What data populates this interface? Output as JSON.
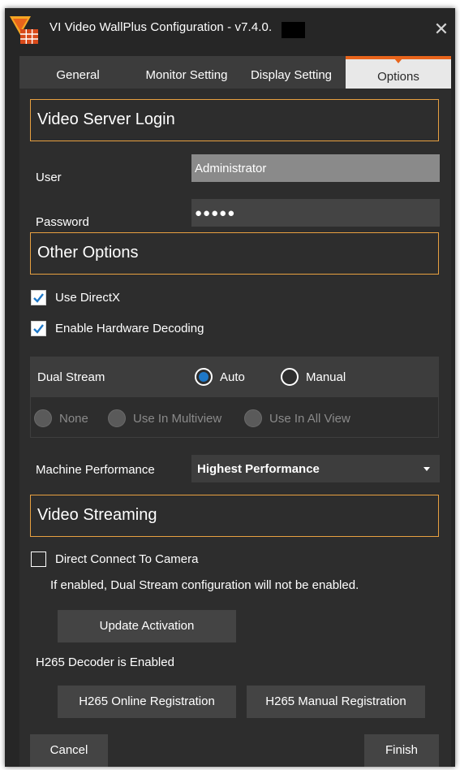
{
  "window": {
    "title": "VI Video WallPlus Configuration - v7.4.0.",
    "close_glyph": "✕"
  },
  "tabs": [
    {
      "label": "General",
      "active": false
    },
    {
      "label": "Monitor Setting",
      "active": false
    },
    {
      "label": "Display Setting",
      "active": false
    },
    {
      "label": "Options",
      "active": true
    }
  ],
  "login": {
    "section_title": "Video Server Login",
    "user_label": "User",
    "user_value": "Administrator",
    "password_label": "Password",
    "password_value": "●●●●●"
  },
  "other": {
    "section_title": "Other Options",
    "use_directx": {
      "label": "Use DirectX",
      "checked": true
    },
    "hw_decoding": {
      "label": "Enable Hardware Decoding",
      "checked": true
    },
    "dual_stream": {
      "label": "Dual Stream",
      "auto": "Auto",
      "manual": "Manual",
      "selected": "Auto",
      "sub_options": [
        "None",
        "Use In Multiview",
        "Use In All View"
      ]
    },
    "machine_performance": {
      "label": "Machine Performance",
      "value": "Highest Performance"
    }
  },
  "streaming": {
    "section_title": "Video Streaming",
    "direct_connect": {
      "label": "Direct Connect To Camera",
      "checked": false
    },
    "note": "If enabled, Dual Stream configuration will not be enabled.",
    "update_activation": "Update Activation",
    "h265_status": "H265 Decoder is Enabled",
    "h265_online": "H265 Online Registration",
    "h265_manual": "H265 Manual Registration"
  },
  "footer": {
    "cancel": "Cancel",
    "finish": "Finish"
  },
  "colors": {
    "background": "#262626",
    "panel": "#2d2d2d",
    "accent_orange": "#e8641b",
    "section_border": "#e8a040",
    "check_blue": "#1e78c8"
  },
  "icons": {
    "app_logo": "video-wall-logo-icon",
    "close": "close-icon",
    "checkmark": "checkmark-icon",
    "dropdown": "chevron-down-icon"
  }
}
